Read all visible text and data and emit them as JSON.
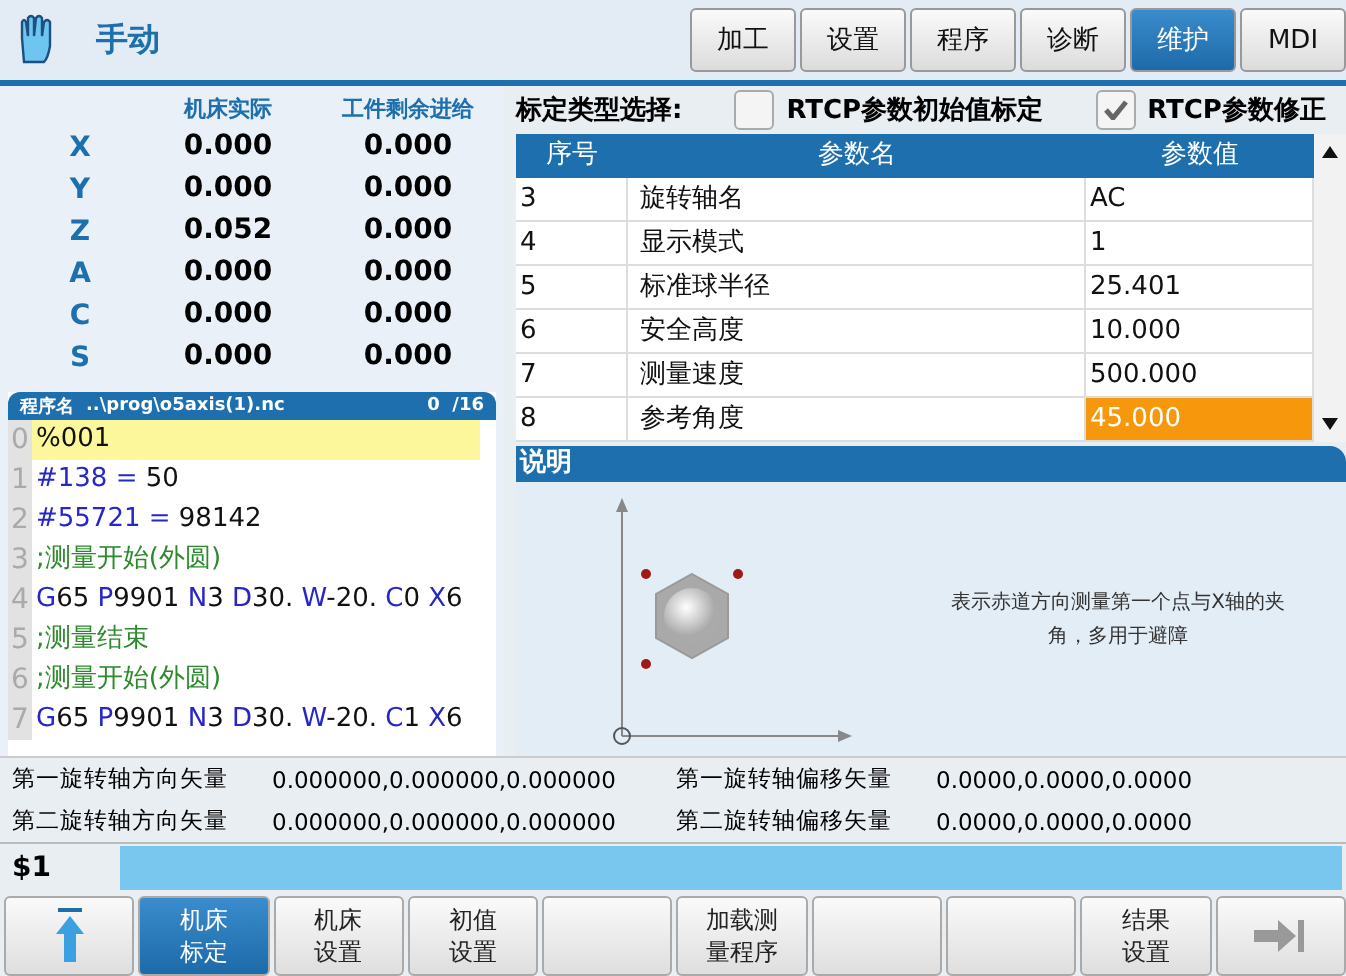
{
  "header": {
    "mode": "手动",
    "tabs": [
      {
        "label": "加工",
        "selected": false
      },
      {
        "label": "设置",
        "selected": false
      },
      {
        "label": "程序",
        "selected": false
      },
      {
        "label": "诊断",
        "selected": false
      },
      {
        "label": "维护",
        "selected": true
      },
      {
        "label": "MDI",
        "selected": false
      }
    ]
  },
  "coords": {
    "columns": [
      "机床实际",
      "工件剩余进给"
    ],
    "rows": [
      {
        "axis": "X",
        "actual": "0.000",
        "remaining": "0.000"
      },
      {
        "axis": "Y",
        "actual": "0.000",
        "remaining": "0.000"
      },
      {
        "axis": "Z",
        "actual": "0.052",
        "remaining": "0.000"
      },
      {
        "axis": "A",
        "actual": "0.000",
        "remaining": "0.000"
      },
      {
        "axis": "C",
        "actual": "0.000",
        "remaining": "0.000"
      },
      {
        "axis": "S",
        "actual": "0.000",
        "remaining": "0.000"
      }
    ]
  },
  "program": {
    "label": "程序名",
    "path": "..\\prog\\o5axis(1).nc",
    "position": "0  /16",
    "lines": [
      {
        "number": "0",
        "selected": true,
        "tokens": [
          {
            "kind": "text",
            "text": "%001"
          }
        ]
      },
      {
        "number": "1",
        "selected": false,
        "tokens": [
          {
            "kind": "addr",
            "text": "#138 = "
          },
          {
            "kind": "text",
            "text": "50"
          }
        ]
      },
      {
        "number": "2",
        "selected": false,
        "tokens": [
          {
            "kind": "addr",
            "text": "#55721 = "
          },
          {
            "kind": "text",
            "text": "98142"
          }
        ]
      },
      {
        "number": "3",
        "selected": false,
        "tokens": [
          {
            "kind": "comment",
            "text": ";测量开始(外圆)"
          }
        ]
      },
      {
        "number": "4",
        "selected": false,
        "tokens": [
          {
            "kind": "addr",
            "text": "G"
          },
          {
            "kind": "text",
            "text": "65 "
          },
          {
            "kind": "addr",
            "text": "P"
          },
          {
            "kind": "text",
            "text": "9901 "
          },
          {
            "kind": "addr",
            "text": "N"
          },
          {
            "kind": "text",
            "text": "3 "
          },
          {
            "kind": "addr",
            "text": "D"
          },
          {
            "kind": "text",
            "text": "30. "
          },
          {
            "kind": "addr",
            "text": "W"
          },
          {
            "kind": "text",
            "text": "-20. "
          },
          {
            "kind": "addr",
            "text": "C"
          },
          {
            "kind": "text",
            "text": "0 "
          },
          {
            "kind": "addr",
            "text": "X"
          },
          {
            "kind": "text",
            "text": "6"
          }
        ]
      },
      {
        "number": "5",
        "selected": false,
        "tokens": [
          {
            "kind": "comment",
            "text": ";测量结束"
          }
        ]
      },
      {
        "number": "6",
        "selected": false,
        "tokens": [
          {
            "kind": "comment",
            "text": ";测量开始(外圆)"
          }
        ]
      },
      {
        "number": "7",
        "selected": false,
        "tokens": [
          {
            "kind": "addr",
            "text": "G"
          },
          {
            "kind": "text",
            "text": "65 "
          },
          {
            "kind": "addr",
            "text": "P"
          },
          {
            "kind": "text",
            "text": "9901 "
          },
          {
            "kind": "addr",
            "text": "N"
          },
          {
            "kind": "text",
            "text": "3 "
          },
          {
            "kind": "addr",
            "text": "D"
          },
          {
            "kind": "text",
            "text": "30. "
          },
          {
            "kind": "addr",
            "text": "W"
          },
          {
            "kind": "text",
            "text": "-20. "
          },
          {
            "kind": "addr",
            "text": "C"
          },
          {
            "kind": "text",
            "text": "1 "
          },
          {
            "kind": "addr",
            "text": "X"
          },
          {
            "kind": "text",
            "text": "6"
          }
        ]
      }
    ]
  },
  "calibration": {
    "label": "标定类型选择:",
    "options": [
      {
        "label": "RTCP参数初始值标定",
        "checked": false
      },
      {
        "label": "RTCP参数修正",
        "checked": true
      }
    ]
  },
  "params": {
    "columns": [
      "序号",
      "参数名",
      "参数值"
    ],
    "rows": [
      {
        "index": "3",
        "name": "旋转轴名",
        "value": "AC",
        "selected": false
      },
      {
        "index": "4",
        "name": "显示模式",
        "value": "1",
        "selected": false
      },
      {
        "index": "5",
        "name": "标准球半径",
        "value": "25.401",
        "selected": false
      },
      {
        "index": "6",
        "name": "安全高度",
        "value": "10.000",
        "selected": false
      },
      {
        "index": "7",
        "name": "测量速度",
        "value": "500.000",
        "selected": false
      },
      {
        "index": "8",
        "name": "参考角度",
        "value": "45.000",
        "selected": true
      }
    ]
  },
  "description": {
    "title": "说明",
    "text": "表示赤道方向测量第一个点与X轴的夹角，多用于避障"
  },
  "vectors": [
    {
      "label": "第一旋转轴方向矢量",
      "value": "0.000000,0.000000,0.000000"
    },
    {
      "label": "第一旋转轴偏移矢量",
      "value": "0.0000,0.0000,0.0000"
    },
    {
      "label": "第二旋转轴方向矢量",
      "value": "0.000000,0.000000,0.000000"
    },
    {
      "label": "第二旋转轴偏移矢量",
      "value": "0.0000,0.0000,0.0000"
    }
  ],
  "command": {
    "prompt": "$1"
  },
  "softkeys": [
    {
      "kind": "up",
      "selected": false
    },
    {
      "kind": "text",
      "lines": [
        "机床",
        "标定"
      ],
      "selected": true
    },
    {
      "kind": "text",
      "lines": [
        "机床",
        "设置"
      ],
      "selected": false
    },
    {
      "kind": "text",
      "lines": [
        "初值",
        "设置"
      ],
      "selected": false
    },
    {
      "kind": "empty",
      "selected": false
    },
    {
      "kind": "text",
      "lines": [
        "加载测",
        "量程序"
      ],
      "selected": false
    },
    {
      "kind": "empty",
      "selected": false
    },
    {
      "kind": "empty",
      "selected": false
    },
    {
      "kind": "text",
      "lines": [
        "结果",
        "设置"
      ],
      "selected": false
    },
    {
      "kind": "next",
      "selected": false
    }
  ]
}
